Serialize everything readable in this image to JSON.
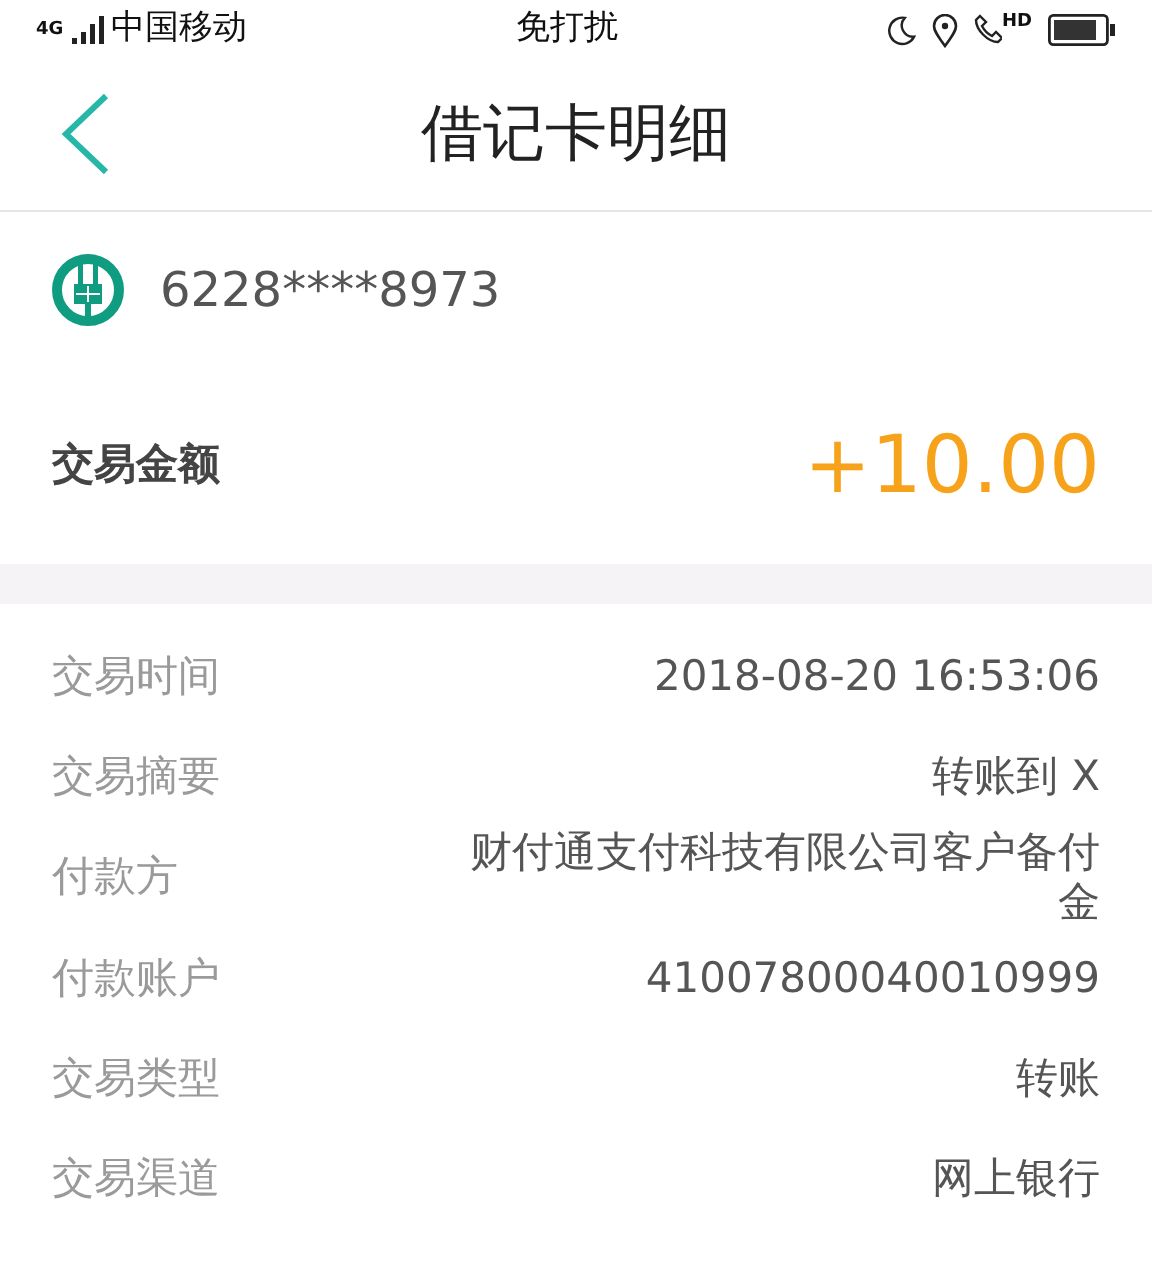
{
  "status_bar": {
    "network": "4G",
    "carrier": "中国移动",
    "mode": "免打扰",
    "call_badge": "HD"
  },
  "header": {
    "title": "借记卡明细"
  },
  "card": {
    "number": "6228****8973"
  },
  "amount": {
    "label": "交易金额",
    "value": "+10.00"
  },
  "details": [
    {
      "label": "交易时间",
      "value": "2018-08-20 16:53:06"
    },
    {
      "label": "交易摘要",
      "value": "转账到 X"
    },
    {
      "label": "付款方",
      "value": "财付通支付科技有限公司客户备付金"
    },
    {
      "label": "付款账户",
      "value": "41007800040010999"
    },
    {
      "label": "交易类型",
      "value": "转账"
    },
    {
      "label": "交易渠道",
      "value": "网上银行"
    }
  ]
}
